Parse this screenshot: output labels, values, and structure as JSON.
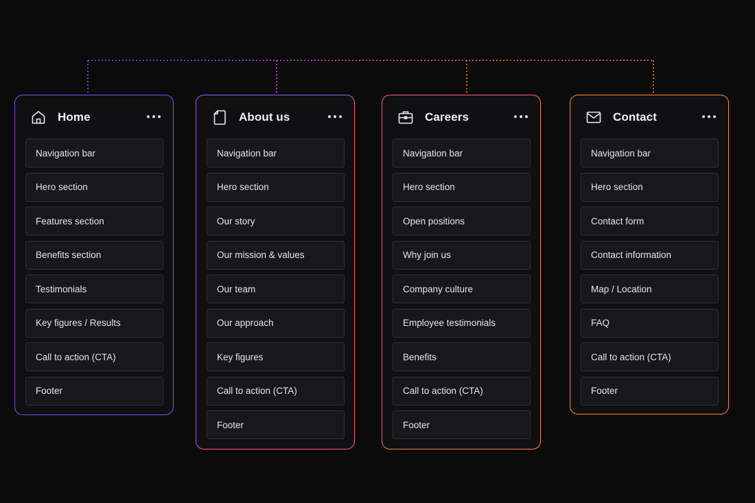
{
  "colors": {
    "home": "#8a4cf0",
    "about_from": "#a55cf0",
    "about_to": "#ff5a7a",
    "careers_from": "#ff5a7a",
    "careers_to": "#ff8a3a",
    "contact": "#ff8a2a"
  },
  "pages": [
    {
      "id": "home",
      "icon": "home-icon",
      "title": "Home",
      "sections": [
        "Navigation bar",
        "Hero section",
        "Features section",
        "Benefits section",
        "Testimonials",
        "Key figures / Results",
        "Call to action (CTA)",
        "Footer"
      ]
    },
    {
      "id": "about",
      "icon": "document-icon",
      "title": "About us",
      "sections": [
        "Navigation bar",
        "Hero section",
        "Our story",
        "Our mission & values",
        "Our team",
        "Our approach",
        "Key figures",
        "Call to action (CTA)",
        "Footer"
      ]
    },
    {
      "id": "careers",
      "icon": "briefcase-icon",
      "title": "Careers",
      "sections": [
        "Navigation bar",
        "Hero section",
        "Open positions",
        "Why join us",
        "Company culture",
        "Employee testimonials",
        "Benefits",
        "Call to action (CTA)",
        "Footer"
      ]
    },
    {
      "id": "contact",
      "icon": "mail-icon",
      "title": "Contact",
      "sections": [
        "Navigation bar",
        "Hero section",
        "Contact form",
        "Contact information",
        "Map / Location",
        "FAQ",
        "Call to action (CTA)",
        "Footer"
      ]
    }
  ]
}
